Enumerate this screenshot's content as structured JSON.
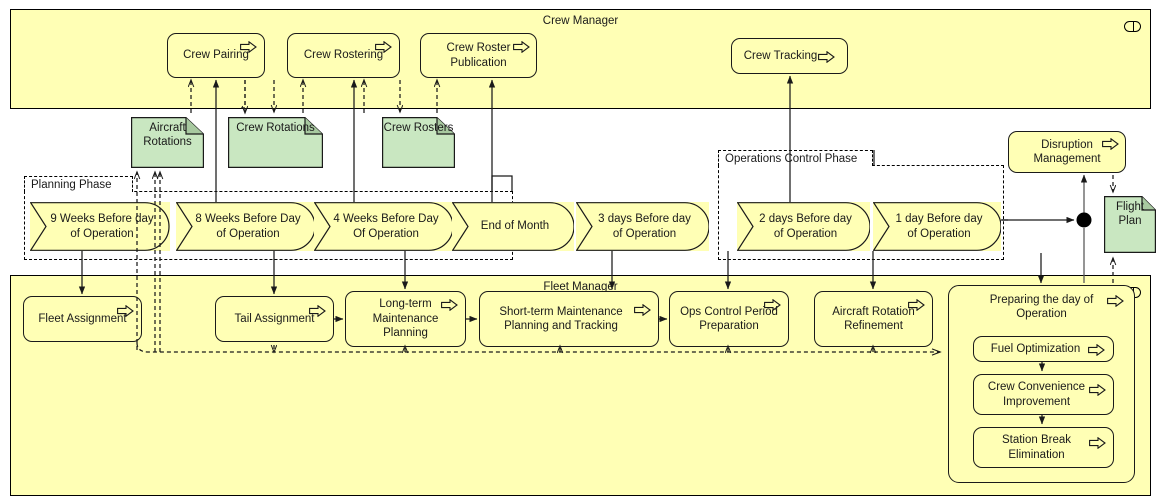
{
  "diagram": {
    "type": "archimate-business-process",
    "colors": {
      "process_fill": "#ffffb5",
      "artifact_fill": "#c9e7c1",
      "line": "#1a1a1a",
      "group_border": "#000000"
    }
  },
  "lanes": [
    {
      "id": "crew_manager",
      "title": "Crew Manager",
      "icon": "role-icon"
    },
    {
      "id": "fleet_manager",
      "title": "Fleet Manager",
      "icon": "role-icon"
    }
  ],
  "groups": [
    {
      "id": "planning_phase",
      "label": "Planning Phase"
    },
    {
      "id": "ops_control_phase",
      "label": "Operations Control Phase"
    }
  ],
  "crew_manager_processes": [
    {
      "id": "crew_pairing",
      "label": "Crew Pairing",
      "marker": "process-arrow-icon"
    },
    {
      "id": "crew_rostering",
      "label": "Crew Rostering",
      "marker": "process-arrow-icon"
    },
    {
      "id": "crew_roster_publication",
      "label": "Crew Roster Publication",
      "marker": "process-arrow-icon"
    },
    {
      "id": "crew_tracking",
      "label": "Crew Tracking",
      "marker": "process-arrow-icon"
    }
  ],
  "artifacts": [
    {
      "id": "aircraft_rotations",
      "label": "Aircraft Rotations",
      "icon": "document-icon"
    },
    {
      "id": "crew_rotations",
      "label": "Crew Rotations",
      "icon": "document-icon"
    },
    {
      "id": "crew_rosters",
      "label": "Crew Rosters",
      "icon": "document-icon"
    },
    {
      "id": "flight_plan",
      "label": "Flight Plan",
      "icon": "document-icon"
    }
  ],
  "events": [
    {
      "id": "e9w",
      "label": "9 Weeks Before day of Operation",
      "phase": "planning_phase"
    },
    {
      "id": "e8w",
      "label": "8 Weeks Before Day of Operation",
      "phase": "planning_phase"
    },
    {
      "id": "e4w",
      "label": "4 Weeks Before Day Of Operation",
      "phase": "planning_phase"
    },
    {
      "id": "eom",
      "label": "End of Month",
      "phase": "planning_phase"
    },
    {
      "id": "e3d",
      "label": "3 days Before day of Operation",
      "phase": "planning_phase"
    },
    {
      "id": "e2d",
      "label": "2 days Before day of Operation",
      "phase": "ops_control_phase"
    },
    {
      "id": "e1d",
      "label": "1 day Before day of Operation",
      "phase": "ops_control_phase"
    }
  ],
  "standalone_processes": [
    {
      "id": "disruption_management",
      "label": "Disruption Management",
      "marker": "process-arrow-icon"
    }
  ],
  "fleet_manager_processes": [
    {
      "id": "fleet_assignment",
      "label": "Fleet Assignment",
      "marker": "process-arrow-icon"
    },
    {
      "id": "tail_assignment",
      "label": "Tail Assignment",
      "marker": "process-arrow-icon"
    },
    {
      "id": "long_term_maintenance",
      "label": "Long-term Maintenance Planning",
      "marker": "process-arrow-icon"
    },
    {
      "id": "short_term_maintenance",
      "label": "Short-term Maintenance Planning and Tracking",
      "marker": "process-arrow-icon"
    },
    {
      "id": "ops_control_prep",
      "label": "Ops Control Period Preparation",
      "marker": "process-arrow-icon"
    },
    {
      "id": "aircraft_rotation_refine",
      "label": "Aircraft Rotation Refinement",
      "marker": "process-arrow-icon"
    }
  ],
  "preparing_day": {
    "id": "preparing_day_of_operation",
    "label": "Preparing the day of Operation",
    "marker": "process-arrow-icon",
    "children": [
      {
        "id": "fuel_optimization",
        "label": "Fuel Optimization",
        "marker": "process-arrow-icon"
      },
      {
        "id": "crew_convenience",
        "label": "Crew Convenience Improvement",
        "marker": "process-arrow-icon"
      },
      {
        "id": "station_break",
        "label": "Station Break Elimination",
        "marker": "process-arrow-icon"
      }
    ]
  },
  "junction": {
    "id": "and-junction",
    "icon": "junction-dot"
  }
}
